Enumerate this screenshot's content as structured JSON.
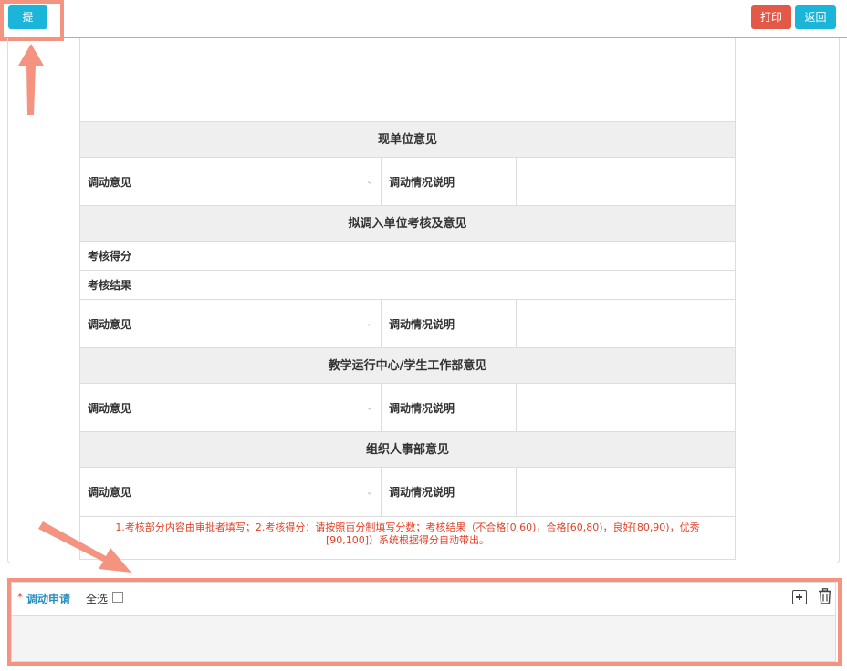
{
  "toolbar": {
    "submit_label": "提交",
    "print_label": "打印",
    "back_label": "返回"
  },
  "sections": [
    {
      "title": "现单位意见",
      "rows": [
        {
          "label": "调动意见",
          "right_label": "调动情况说明"
        }
      ]
    },
    {
      "title": "拟调入单位考核及意见",
      "score_label": "考核得分",
      "result_label": "考核结果",
      "rows": [
        {
          "label": "调动意见",
          "right_label": "调动情况说明"
        }
      ]
    },
    {
      "title": "教学运行中心/学生工作部意见",
      "rows": [
        {
          "label": "调动意见",
          "right_label": "调动情况说明"
        }
      ]
    },
    {
      "title": "组织人事部意见",
      "rows": [
        {
          "label": "调动意见",
          "right_label": "调动情况说明"
        }
      ]
    }
  ],
  "note_line1": "1.考核部分内容由审批者填写；2.考核得分：请按照百分制填写分数；考核结果（不合格[0,60)，合格[60,80)，良好[80,90)，优秀",
  "note_line2": "[90,100]）系统根据得分自动带出。",
  "bottom": {
    "required_mark": "*",
    "title": "调动申请",
    "select_all_label": "全选"
  },
  "icons": {
    "add": "plus-square-icon",
    "delete": "trash-icon",
    "select_arrow": "chevron-down-icon"
  },
  "colors": {
    "primary": "#1ab5d9",
    "danger": "#e25a47",
    "highlight": "#f4937f",
    "note": "#e0442a"
  }
}
